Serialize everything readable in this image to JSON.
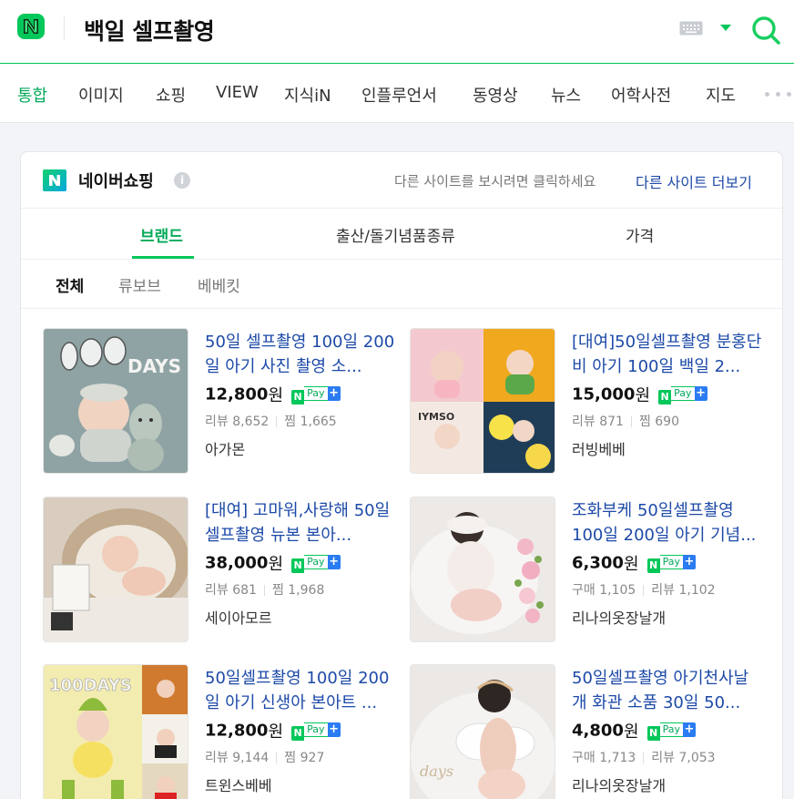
{
  "header": {
    "logo_icon": "naver-n-logo",
    "query": "백일 셀프촬영",
    "keyboard_icon": "keyboard-icon",
    "dropdown_icon": "chevron-down-icon",
    "search_icon": "search-icon"
  },
  "nav": {
    "tabs": [
      {
        "label": "통합",
        "active": true
      },
      {
        "label": "이미지"
      },
      {
        "label": "쇼핑"
      },
      {
        "label": "VIEW"
      },
      {
        "label": "지식iN"
      },
      {
        "label": "인플루언서"
      },
      {
        "label": "동영상"
      },
      {
        "label": "뉴스"
      },
      {
        "label": "어학사전"
      },
      {
        "label": "지도"
      }
    ],
    "more_icon": "more-dots-icon"
  },
  "shopping": {
    "title": "네이버쇼핑",
    "info_icon": "info-icon",
    "info_glyph": "i",
    "other_hint": "다른 사이트를 보시려면 클릭하세요",
    "other_link": "다른 사이트 더보기",
    "subtabs": [
      "브랜드",
      "출산/돌기념품종류",
      "가격"
    ],
    "filters": [
      "전체",
      "류보브",
      "베베킷"
    ],
    "npay": {
      "n": "N",
      "pay": "Pay",
      "plus": "+"
    },
    "products": [
      {
        "title": "50일 셀프촬영 100일 200일 아기 사진 촬영 소...",
        "price": "12,800",
        "unit": "원",
        "stat1": "리뷰 8,652",
        "stat2": "찜 1,665",
        "store": "아가몬"
      },
      {
        "title": "[대여]50일셀프촬영 분홍단비 아기 100일 백일 2...",
        "price": "15,000",
        "unit": "원",
        "stat1": "리뷰 871",
        "stat2": "찜 690",
        "store": "러빙베베"
      },
      {
        "title": "[대여] 고마워,사랑해 50일셀프촬영 뉴본 본아...",
        "price": "38,000",
        "unit": "원",
        "stat1": "리뷰 681",
        "stat2": "찜 1,968",
        "store": "세이아모르"
      },
      {
        "title": "조화부케 50일셀프촬영 100일 200일 아기 기념...",
        "price": "6,300",
        "unit": "원",
        "stat1": "구매 1,105",
        "stat2": "리뷰 1,102",
        "store": "리나의옷장날개"
      },
      {
        "title": "50일셀프촬영 100일 200일 아기 신생아 본아트 ...",
        "price": "12,800",
        "unit": "원",
        "stat1": "리뷰 9,144",
        "stat2": "찜 927",
        "store": "트윈스베베"
      },
      {
        "title": "50일셀프촬영 아기천사날개 화관 소품 30일 50...",
        "price": "4,800",
        "unit": "원",
        "stat1": "구매 1,713",
        "stat2": "리뷰 7,053",
        "store": "리나의옷장날개"
      }
    ]
  },
  "colors": {
    "brand_green": "#03c75a",
    "link_blue": "#1d4aa8",
    "npay_plus_blue": "#2b7cf2"
  }
}
